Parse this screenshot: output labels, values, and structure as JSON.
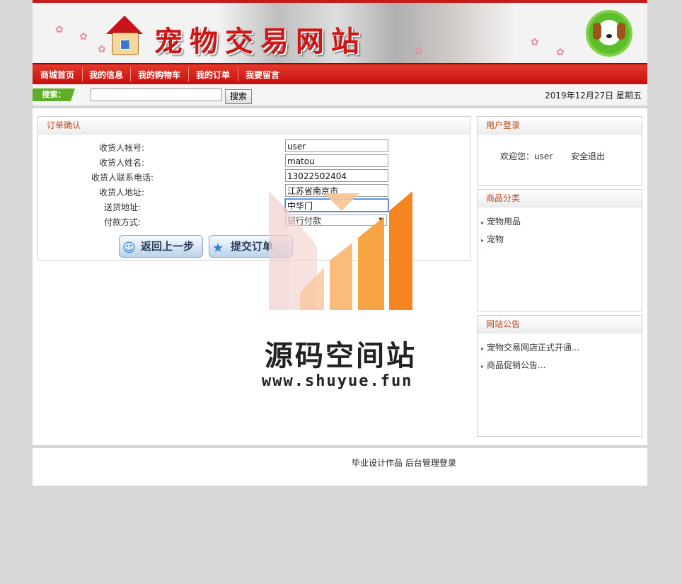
{
  "banner": {
    "title": "宠物交易网站"
  },
  "nav": {
    "items": [
      "商城首页",
      "我的信息",
      "我的购物车",
      "我的订单",
      "我要留言"
    ]
  },
  "search": {
    "tag_label": "搜索：",
    "input_value": "",
    "button_label": "搜索"
  },
  "date_text": "2019年12月27日 星期五",
  "order": {
    "header": "订单确认",
    "fields": [
      {
        "label": "收货人帐号:",
        "value": "user"
      },
      {
        "label": "收货人姓名:",
        "value": "matou"
      },
      {
        "label": "收货人联系电话:",
        "value": "13022502404"
      },
      {
        "label": "收货人地址:",
        "value": "江苏省南京市"
      },
      {
        "label": "送货地址:",
        "value": "中华门"
      },
      {
        "label": "付款方式:",
        "value": "银行付款"
      }
    ],
    "back_button": "返回上一步",
    "submit_button": "提交订单"
  },
  "login": {
    "header": "用户登录",
    "welcome": "欢迎您：user",
    "logout": "安全退出"
  },
  "category": {
    "header": "商品分类",
    "items": [
      "宠物用品",
      "宠物"
    ]
  },
  "notice": {
    "header": "网站公告",
    "items": [
      "宠物交易网店正式开通...",
      "商品促销公告..."
    ]
  },
  "footer": {
    "text": "毕业设计作品 后台管理登录"
  },
  "watermark": {
    "title": "源码空间站",
    "url": "www.shuyue.fun"
  },
  "colors": {
    "accent_red": "#c80f0f",
    "panel_title": "#c0451a",
    "search_green": "#5fae28",
    "watermark_orange": "#f5861f"
  }
}
